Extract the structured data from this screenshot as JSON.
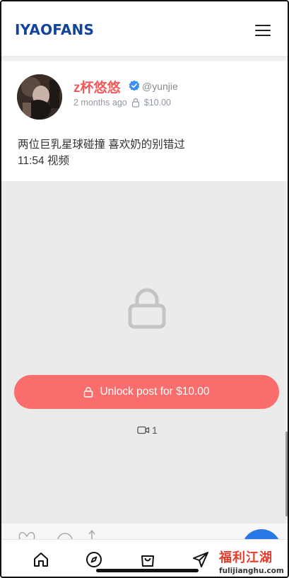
{
  "header": {
    "logo": "IYAOFANS",
    "menu_icon": "hamburger-menu-icon"
  },
  "post": {
    "author_name": "z杯悠悠",
    "handle": "@yunjie",
    "time": "2 months ago",
    "price": "$10.00",
    "verified_icon": "verified-badge-icon",
    "text_line1": "两位巨乳星球碰撞 喜欢奶的别错过",
    "text_line2": "11:54 视频"
  },
  "locked": {
    "lock_icon": "lock-icon",
    "unlock_label": "Unlock post for $10.00",
    "video_count": "1",
    "colors": {
      "button": "#fa6d6d",
      "background": "#ebebeb"
    }
  },
  "bottom_nav": {
    "items": [
      {
        "icon": "home-icon"
      },
      {
        "icon": "compass-icon"
      },
      {
        "icon": "shopping-bag-icon"
      },
      {
        "icon": "send-icon"
      }
    ]
  },
  "watermark": {
    "text": "福利江湖",
    "url": "fulijianghu.com"
  },
  "colors": {
    "brand": "#12449b",
    "author": "#f05a5a",
    "fab": "#2879e6"
  }
}
